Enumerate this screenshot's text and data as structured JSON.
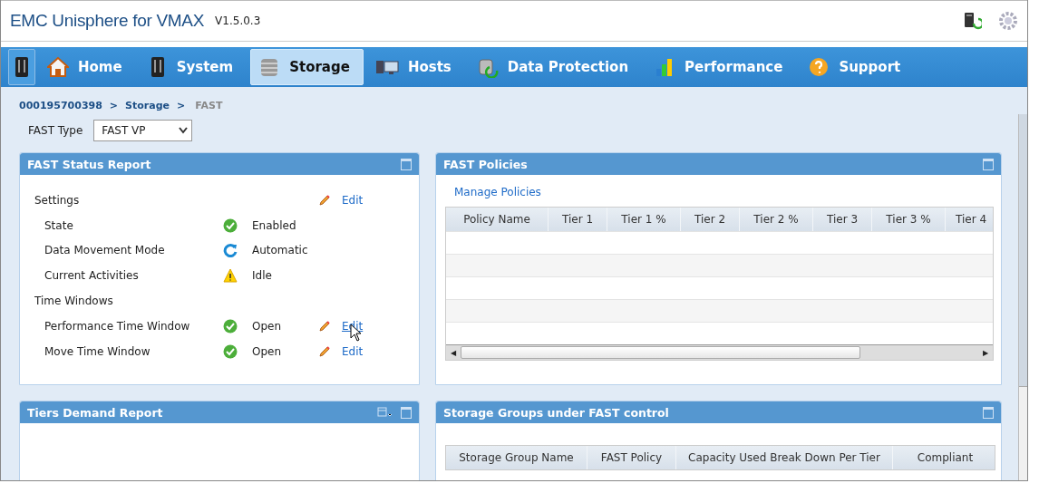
{
  "app": {
    "title": "EMC Unisphere for VMAX",
    "version": "V1.5.0.3"
  },
  "nav": [
    {
      "selected": false
    },
    {
      "label": "Home",
      "selected": false
    },
    {
      "label": "System",
      "selected": false
    },
    {
      "label": "Storage",
      "selected": true
    },
    {
      "label": "Hosts",
      "selected": false
    },
    {
      "label": "Data Protection",
      "selected": false
    },
    {
      "label": "Performance",
      "selected": false
    },
    {
      "label": "Support",
      "selected": false
    }
  ],
  "breadcrumb": [
    "000195700398",
    ">",
    "Storage",
    ">",
    "FAST"
  ],
  "fast_type": {
    "label": "FAST Type",
    "value": "FAST VP"
  },
  "status_report": {
    "title": "FAST Status Report",
    "rows": [
      {
        "kind": "heading",
        "label": "Settings",
        "edit": "Edit"
      },
      {
        "kind": "ok",
        "label": "State",
        "value": "Enabled"
      },
      {
        "kind": "mode",
        "label": "Data Movement Mode",
        "value": "Automatic"
      },
      {
        "kind": "warning",
        "label": "Current Activities",
        "value": "Idle"
      },
      {
        "kind": "heading",
        "label": "Time Windows"
      },
      {
        "kind": "ok",
        "label": "Performance Time Window",
        "value": "Open",
        "edit": "Edit",
        "hover": true
      },
      {
        "kind": "ok",
        "label": "Move Time Window",
        "value": "Open",
        "edit": "Edit",
        "hover": false
      }
    ]
  },
  "policies": {
    "title": "FAST Policies",
    "link": "Manage Policies",
    "columns": [
      "Policy Name",
      "Tier 1",
      "Tier 1 %",
      "Tier 2",
      "Tier 2 %",
      "Tier 3",
      "Tier 3 %",
      "Tier 4"
    ],
    "scroll_left": "◀",
    "scroll_right": "▶"
  },
  "tiers_demand": {
    "title": "Tiers Demand Report"
  },
  "storage_groups": {
    "title": "Storage Groups under FAST control",
    "columns": [
      "Storage Group Name",
      "FAST Policy",
      "Capacity Used Break Down Per Tier",
      "Compliant"
    ]
  }
}
